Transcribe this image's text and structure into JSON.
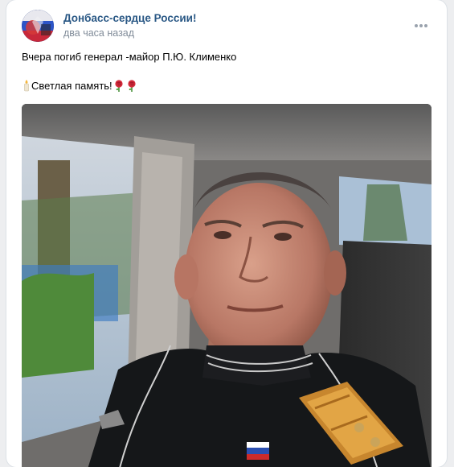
{
  "post": {
    "group_name": "Донбасс-сердце России!",
    "time": "два часа назад",
    "text_line_1": "Вчера погиб генерал -майор П.Ю. Клименко",
    "text_line_2": "Светлая память!"
  },
  "icons": {
    "avatar": "group-avatar",
    "more": "more-dots-icon",
    "candle": "candle-emoji",
    "rose": "rose-emoji"
  },
  "colors": {
    "link": "#2a5885",
    "meta": "#818c99",
    "background": "#edeef0",
    "card": "#ffffff"
  }
}
